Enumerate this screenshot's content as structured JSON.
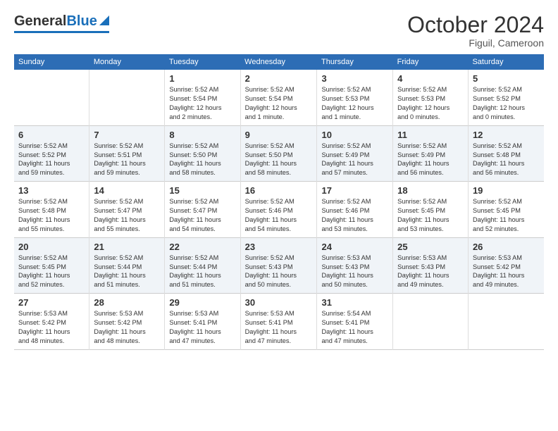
{
  "logo": {
    "general": "General",
    "blue": "Blue"
  },
  "title": "October 2024",
  "location": "Figuil, Cameroon",
  "headers": [
    "Sunday",
    "Monday",
    "Tuesday",
    "Wednesday",
    "Thursday",
    "Friday",
    "Saturday"
  ],
  "weeks": [
    [
      {
        "day": "",
        "info": ""
      },
      {
        "day": "",
        "info": ""
      },
      {
        "day": "1",
        "info": "Sunrise: 5:52 AM\nSunset: 5:54 PM\nDaylight: 12 hours\nand 2 minutes."
      },
      {
        "day": "2",
        "info": "Sunrise: 5:52 AM\nSunset: 5:54 PM\nDaylight: 12 hours\nand 1 minute."
      },
      {
        "day": "3",
        "info": "Sunrise: 5:52 AM\nSunset: 5:53 PM\nDaylight: 12 hours\nand 1 minute."
      },
      {
        "day": "4",
        "info": "Sunrise: 5:52 AM\nSunset: 5:53 PM\nDaylight: 12 hours\nand 0 minutes."
      },
      {
        "day": "5",
        "info": "Sunrise: 5:52 AM\nSunset: 5:52 PM\nDaylight: 12 hours\nand 0 minutes."
      }
    ],
    [
      {
        "day": "6",
        "info": "Sunrise: 5:52 AM\nSunset: 5:52 PM\nDaylight: 11 hours\nand 59 minutes."
      },
      {
        "day": "7",
        "info": "Sunrise: 5:52 AM\nSunset: 5:51 PM\nDaylight: 11 hours\nand 59 minutes."
      },
      {
        "day": "8",
        "info": "Sunrise: 5:52 AM\nSunset: 5:50 PM\nDaylight: 11 hours\nand 58 minutes."
      },
      {
        "day": "9",
        "info": "Sunrise: 5:52 AM\nSunset: 5:50 PM\nDaylight: 11 hours\nand 58 minutes."
      },
      {
        "day": "10",
        "info": "Sunrise: 5:52 AM\nSunset: 5:49 PM\nDaylight: 11 hours\nand 57 minutes."
      },
      {
        "day": "11",
        "info": "Sunrise: 5:52 AM\nSunset: 5:49 PM\nDaylight: 11 hours\nand 56 minutes."
      },
      {
        "day": "12",
        "info": "Sunrise: 5:52 AM\nSunset: 5:48 PM\nDaylight: 11 hours\nand 56 minutes."
      }
    ],
    [
      {
        "day": "13",
        "info": "Sunrise: 5:52 AM\nSunset: 5:48 PM\nDaylight: 11 hours\nand 55 minutes."
      },
      {
        "day": "14",
        "info": "Sunrise: 5:52 AM\nSunset: 5:47 PM\nDaylight: 11 hours\nand 55 minutes."
      },
      {
        "day": "15",
        "info": "Sunrise: 5:52 AM\nSunset: 5:47 PM\nDaylight: 11 hours\nand 54 minutes."
      },
      {
        "day": "16",
        "info": "Sunrise: 5:52 AM\nSunset: 5:46 PM\nDaylight: 11 hours\nand 54 minutes."
      },
      {
        "day": "17",
        "info": "Sunrise: 5:52 AM\nSunset: 5:46 PM\nDaylight: 11 hours\nand 53 minutes."
      },
      {
        "day": "18",
        "info": "Sunrise: 5:52 AM\nSunset: 5:45 PM\nDaylight: 11 hours\nand 53 minutes."
      },
      {
        "day": "19",
        "info": "Sunrise: 5:52 AM\nSunset: 5:45 PM\nDaylight: 11 hours\nand 52 minutes."
      }
    ],
    [
      {
        "day": "20",
        "info": "Sunrise: 5:52 AM\nSunset: 5:45 PM\nDaylight: 11 hours\nand 52 minutes."
      },
      {
        "day": "21",
        "info": "Sunrise: 5:52 AM\nSunset: 5:44 PM\nDaylight: 11 hours\nand 51 minutes."
      },
      {
        "day": "22",
        "info": "Sunrise: 5:52 AM\nSunset: 5:44 PM\nDaylight: 11 hours\nand 51 minutes."
      },
      {
        "day": "23",
        "info": "Sunrise: 5:52 AM\nSunset: 5:43 PM\nDaylight: 11 hours\nand 50 minutes."
      },
      {
        "day": "24",
        "info": "Sunrise: 5:53 AM\nSunset: 5:43 PM\nDaylight: 11 hours\nand 50 minutes."
      },
      {
        "day": "25",
        "info": "Sunrise: 5:53 AM\nSunset: 5:43 PM\nDaylight: 11 hours\nand 49 minutes."
      },
      {
        "day": "26",
        "info": "Sunrise: 5:53 AM\nSunset: 5:42 PM\nDaylight: 11 hours\nand 49 minutes."
      }
    ],
    [
      {
        "day": "27",
        "info": "Sunrise: 5:53 AM\nSunset: 5:42 PM\nDaylight: 11 hours\nand 48 minutes."
      },
      {
        "day": "28",
        "info": "Sunrise: 5:53 AM\nSunset: 5:42 PM\nDaylight: 11 hours\nand 48 minutes."
      },
      {
        "day": "29",
        "info": "Sunrise: 5:53 AM\nSunset: 5:41 PM\nDaylight: 11 hours\nand 47 minutes."
      },
      {
        "day": "30",
        "info": "Sunrise: 5:53 AM\nSunset: 5:41 PM\nDaylight: 11 hours\nand 47 minutes."
      },
      {
        "day": "31",
        "info": "Sunrise: 5:54 AM\nSunset: 5:41 PM\nDaylight: 11 hours\nand 47 minutes."
      },
      {
        "day": "",
        "info": ""
      },
      {
        "day": "",
        "info": ""
      }
    ]
  ]
}
